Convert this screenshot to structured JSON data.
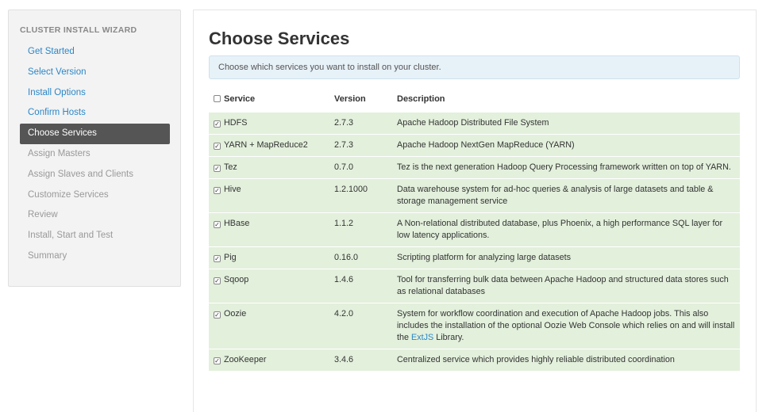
{
  "sidebar": {
    "title": "CLUSTER INSTALL WIZARD",
    "items": [
      {
        "label": "Get Started",
        "state": "done"
      },
      {
        "label": "Select Version",
        "state": "done"
      },
      {
        "label": "Install Options",
        "state": "done"
      },
      {
        "label": "Confirm Hosts",
        "state": "done"
      },
      {
        "label": "Choose Services",
        "state": "active"
      },
      {
        "label": "Assign Masters",
        "state": "pending"
      },
      {
        "label": "Assign Slaves and Clients",
        "state": "pending"
      },
      {
        "label": "Customize Services",
        "state": "pending"
      },
      {
        "label": "Review",
        "state": "pending"
      },
      {
        "label": "Install, Start and Test",
        "state": "pending"
      },
      {
        "label": "Summary",
        "state": "pending"
      }
    ]
  },
  "main": {
    "title": "Choose Services",
    "alert": "Choose which services you want to install on your cluster.",
    "columns": {
      "service": "Service",
      "version": "Version",
      "description": "Description"
    },
    "check_mark": "✓",
    "rows": [
      {
        "service": "HDFS",
        "version": "2.7.3",
        "description": "Apache Hadoop Distributed File System"
      },
      {
        "service": "YARN + MapReduce2",
        "version": "2.7.3",
        "description": "Apache Hadoop NextGen MapReduce (YARN)"
      },
      {
        "service": "Tez",
        "version": "0.7.0",
        "description": "Tez is the next generation Hadoop Query Processing framework written on top of YARN."
      },
      {
        "service": "Hive",
        "version": "1.2.1000",
        "description": "Data warehouse system for ad-hoc queries & analysis of large datasets and table & storage management service"
      },
      {
        "service": "HBase",
        "version": "1.1.2",
        "description": "A Non-relational distributed database, plus Phoenix, a high performance SQL layer for low latency applications."
      },
      {
        "service": "Pig",
        "version": "0.16.0",
        "description": "Scripting platform for analyzing large datasets"
      },
      {
        "service": "Sqoop",
        "version": "1.4.6",
        "description": "Tool for transferring bulk data between Apache Hadoop and structured data stores such as relational databases"
      },
      {
        "service": "Oozie",
        "version": "4.2.0",
        "description_before": "System for workflow coordination and execution of Apache Hadoop jobs. This also includes the installation of the optional Oozie Web Console which relies on and will install the ",
        "description_link": "ExtJS",
        "description_after": " Library."
      },
      {
        "service": "ZooKeeper",
        "version": "3.4.6",
        "description": "Centralized service which provides highly reliable distributed coordination"
      }
    ]
  }
}
